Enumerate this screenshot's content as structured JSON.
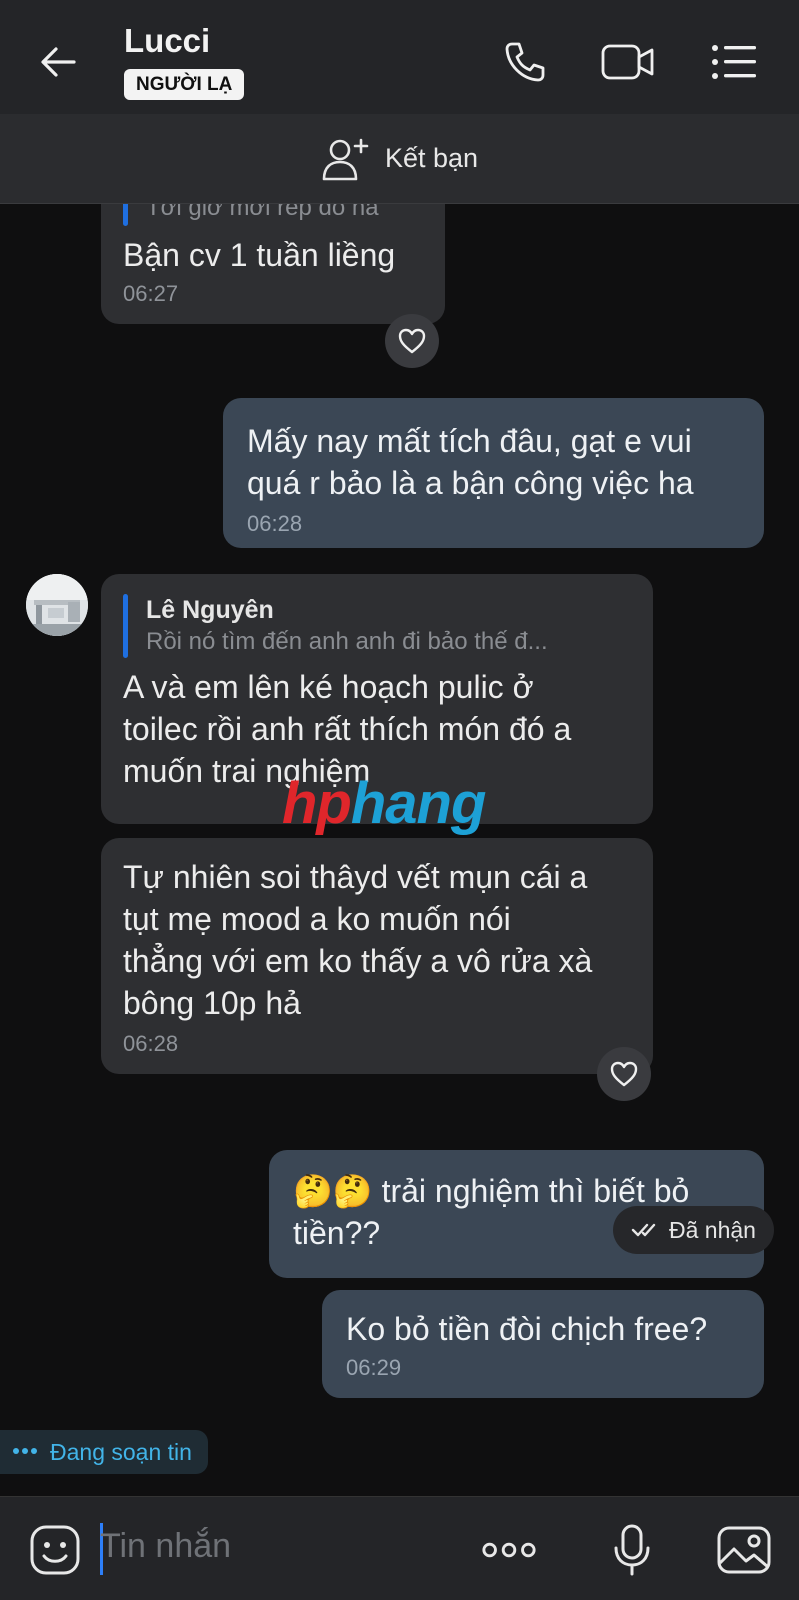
{
  "header": {
    "title": "Lucci",
    "badge": "NGƯỜI LẠ"
  },
  "add_friend": {
    "label": "Kết bạn"
  },
  "messages": [
    {
      "side": "in",
      "quote_partial": "Tới giờ mới rep đó hả",
      "text": "Bận cv 1 tuần liềng",
      "time": "06:27"
    },
    {
      "side": "out",
      "lines": [
        "Mấy nay mất tích đâu, gạt e vui",
        "quá r bảo là a bận công việc ha"
      ],
      "time": "06:28"
    },
    {
      "side": "in",
      "quote_name": "Lê Nguyên",
      "quote_text": "Rồi nó tìm đến anh anh đi bảo thế đ...",
      "lines": [
        "A và em lên ké hoạch pulic ở",
        "toilec rồi anh rất thích món đó a",
        "muốn trai nghiệm"
      ]
    },
    {
      "side": "in",
      "lines": [
        "Tự nhiên soi thâyd vết mụn cái a",
        "tụt mẹ mood a ko muốn nói",
        "thẳng với em ko thấy a vô rửa xà",
        "bông 10p hả"
      ],
      "time": "06:28"
    },
    {
      "side": "out",
      "lines": [
        "🤔🤔 trải nghiệm thì biết bỏ",
        "tiền??"
      ]
    },
    {
      "side": "out",
      "text": "Ko bỏ tiền đòi chịch free?",
      "time": "06:29"
    }
  ],
  "watermark": {
    "part1": "hp",
    "part2": "hang"
  },
  "status": {
    "delivered": "Đã nhận",
    "typing": "Đang soạn tin"
  },
  "input": {
    "placeholder": "Tin nhắn"
  },
  "colors": {
    "background": "#0f0f10",
    "incoming_bubble": "#2e2f32",
    "outgoing_bubble": "#3b4755",
    "accent": "#1f6fe0"
  }
}
